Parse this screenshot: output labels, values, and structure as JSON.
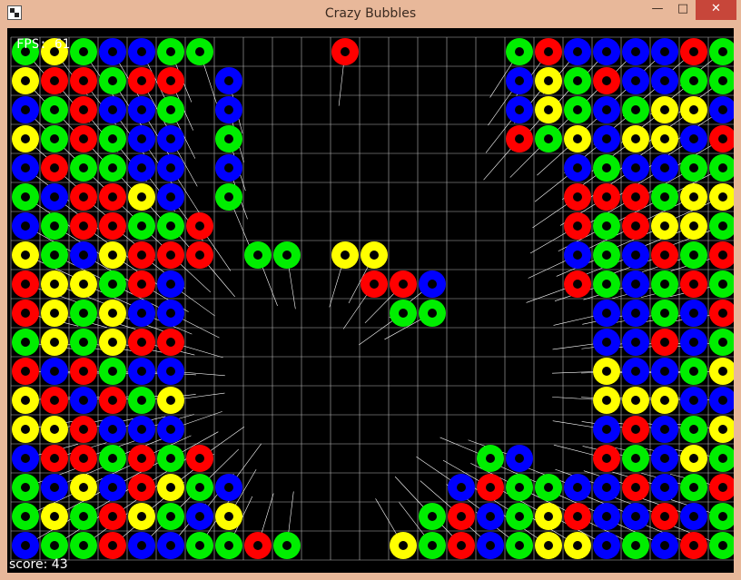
{
  "window": {
    "title": "Crazy Bubbles",
    "icon": "app-icon",
    "controls": {
      "minimize": "—",
      "maximize": "□",
      "close": "✕"
    }
  },
  "hud": {
    "fps_label": "FPS:",
    "fps_value": "61",
    "score_label": "score:",
    "score_value": "43"
  },
  "colors": {
    "background": "#000000",
    "grid": "#b4b4b4",
    "R": "#ff0000",
    "G": "#00ee00",
    "B": "#0000ff",
    "Y": "#ffff00"
  },
  "board": {
    "cols": 25,
    "rows": 18,
    "cells": [
      "GYGBBGG....R.....GRBBBBRGBG",
      "YRRGRR.B.........BYGRBBGGY",
      "BGRBBG.B.........BYGBGYYBBR",
      "YGRGBB.G.........RGYBYYBRR",
      "BRGGBB.B...........BGBBGGRGRRG",
      "GBRRYB.G...........RRRGYYGRBG",
      "BGRRGGR............RGRYYGGRBGY",
      "YGBYRRR.GG.YY......BGBRGRBRRBG",
      "RYYGRB......RRB....RGBGRGBYBRGG",
      "RYGYBB.......GG.....BBGBRBBGGRG",
      "GYGYRR..............BBRBGBBGBGG",
      "RBRGBB..............YBBGYRGRRRB",
      "YRBRGY..............YYYBBBGGRRY",
      "YYRBBB..............BRBGYBRGRGY",
      "BRRGRGR.........GB..RGBYGRGRGRB",
      "GBYBRYGB.......BRGGBBRBGRRGBRB",
      "GYGRYGBY......GRBGYRBBRBGRGBGG",
      "BGGRBBGGRG...YGRBGYYBGBRGYBGB"
    ]
  }
}
